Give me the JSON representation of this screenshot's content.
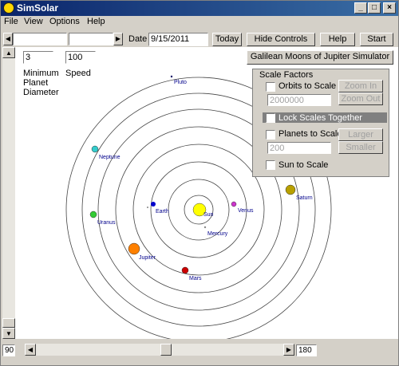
{
  "window": {
    "title": "SimSolar"
  },
  "menu": [
    "File",
    "View",
    "Options",
    "Help"
  ],
  "toolbar": {
    "date_label": "Date",
    "date_value": "9/15/2011",
    "today_button": "Today",
    "hide_controls_button": "Hide Controls",
    "help_button": "Help",
    "start_button": "Start",
    "galilean_button": "Galilean Moons of Jupiter Simulator"
  },
  "controls": {
    "min_planet_diameter_value": "3",
    "min_planet_diameter_label": [
      "Minimum",
      "Planet",
      "Diameter"
    ],
    "speed_value": "100",
    "speed_label": "Speed"
  },
  "scale_factors": {
    "title": "Scale Factors",
    "orbits_to_scale": "Orbits to Scale",
    "orbit_value": "2000000",
    "zoom_in": "Zoom  In",
    "zoom_out": "Zoom Out",
    "lock_scales": "Lock  Scales  Together",
    "planets_to_scale": "Planets to Scale",
    "planet_value": "200",
    "larger": "Larger",
    "smaller": "Smaller",
    "sun_to_scale": "Sun to Scale"
  },
  "bodies": [
    {
      "name": "Sun",
      "color": "#ffff00"
    },
    {
      "name": "Mercury",
      "color": "#888888"
    },
    {
      "name": "Venus",
      "color": "#cc33cc"
    },
    {
      "name": "Earth",
      "color": "#0000cc"
    },
    {
      "name": "Mars",
      "color": "#cc0000"
    },
    {
      "name": "Jupiter",
      "color": "#ff8000"
    },
    {
      "name": "Saturn",
      "color": "#b8a000"
    },
    {
      "name": "Uranus",
      "color": "#33cc33"
    },
    {
      "name": "Neptune",
      "color": "#33cccc"
    },
    {
      "name": "Pluto",
      "color": "#000066"
    }
  ],
  "bottom": {
    "left_value": "90",
    "right_value": "180"
  }
}
